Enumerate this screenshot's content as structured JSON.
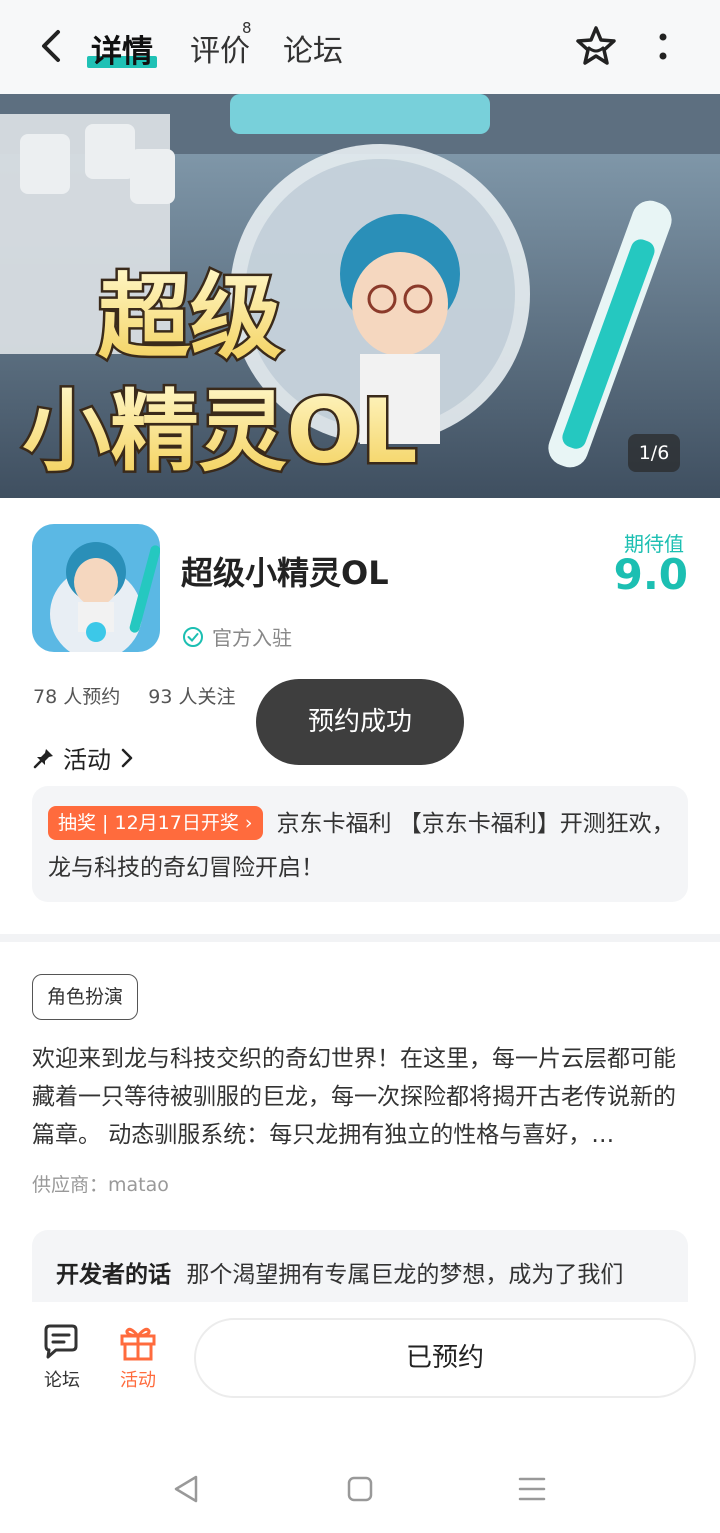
{
  "header": {
    "tabs": [
      {
        "label": "详情",
        "active": true
      },
      {
        "label": "评价",
        "badge": "8"
      },
      {
        "label": "论坛"
      }
    ],
    "accent_color": "#1fc1b5"
  },
  "banner": {
    "logo_text": "超级小精灵OL",
    "counter": "1/6"
  },
  "app": {
    "name": "超级小精灵OL",
    "verified_label": "官方入驻",
    "expect_label": "期待值",
    "expect_value": "9.0",
    "reservations": "78 人预约",
    "followers": "93 人关注"
  },
  "toast": "预约成功",
  "activity": {
    "heading": "活动",
    "chip_type": "抽奖",
    "chip_date": "12月17日开奖",
    "text": "京东卡福利 【京东卡福利】开测狂欢，龙与科技的奇幻冒险开启！"
  },
  "genre_tag": "角色扮演",
  "description": "欢迎来到龙与科技交织的奇幻世界！在这里，每一片云层都可能藏着一只等待被驯服的巨龙，每一次探险都将揭开古老传说新的篇章。 动态驯服系统：每只龙拥有独立的性格与喜好，…",
  "supplier": "供应商：matao",
  "developer": {
    "label": "开发者的话",
    "text": "那个渴望拥有专属巨龙的梦想，成为了我们"
  },
  "bottom": {
    "forum": "论坛",
    "activity": "活动",
    "reserve_button": "已预约"
  }
}
